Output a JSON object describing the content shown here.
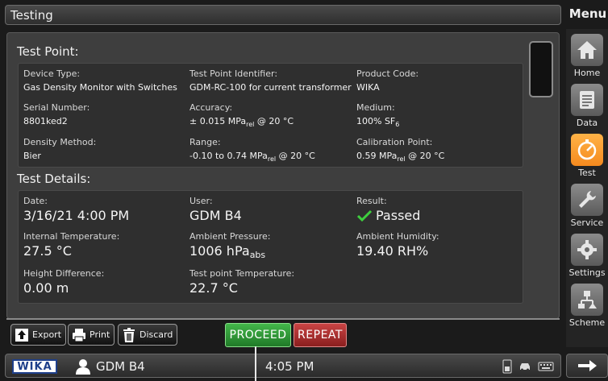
{
  "header": {
    "title": "Testing"
  },
  "menu": {
    "title": "Menu",
    "items": [
      {
        "label": "Home",
        "icon": "home-icon"
      },
      {
        "label": "Data",
        "icon": "document-icon"
      },
      {
        "label": "Test",
        "icon": "gauge-icon",
        "active": true
      },
      {
        "label": "Service",
        "icon": "wrench-icon"
      },
      {
        "label": "Settings",
        "icon": "gear-icon"
      },
      {
        "label": "Scheme",
        "icon": "scheme-icon"
      }
    ]
  },
  "test_point": {
    "title": "Test Point:",
    "device_type": {
      "label": "Device Type:",
      "value": "Gas Density Monitor with Switches"
    },
    "identifier": {
      "label": "Test Point Identifier:",
      "value": "GDM-RC-100 for current transformer"
    },
    "product_code": {
      "label": "Product Code:",
      "value": "WIKA"
    },
    "serial": {
      "label": "Serial Number:",
      "value": "8801ked2"
    },
    "accuracy": {
      "label": "Accuracy:",
      "pre": "± 0.015 MPa",
      "sub": "rel",
      "post": " @ 20 °C"
    },
    "medium": {
      "label": "Medium:",
      "pre": "100% SF",
      "sub": "6"
    },
    "density_method": {
      "label": "Density Method:",
      "value": "Bier"
    },
    "range": {
      "label": "Range:",
      "pre": "-0.10 to 0.74 MPa",
      "sub": "rel",
      "post": " @ 20 °C"
    },
    "calibration": {
      "label": "Calibration Point:",
      "pre": "0.59 MPa",
      "sub": "rel",
      "post": " @ 20 °C"
    }
  },
  "test_details": {
    "title": "Test Details:",
    "date": {
      "label": "Date:",
      "value": "3/16/21 4:00 PM"
    },
    "user": {
      "label": "User:",
      "value": "GDM B4"
    },
    "result": {
      "label": "Result:",
      "value": "Passed"
    },
    "internal_temp": {
      "label": "Internal Temperature:",
      "value": "27.5 °C"
    },
    "ambient_pressure": {
      "label": "Ambient Pressure:",
      "pre": "1006 hPa",
      "sub": "abs"
    },
    "ambient_humidity": {
      "label": "Ambient Humidity:",
      "value": "19.40 RH%"
    },
    "height_diff": {
      "label": "Height Difference:",
      "value": "0.00 m"
    },
    "tp_temp": {
      "label": "Test point Temperature:",
      "value": "22.7 °C"
    }
  },
  "actions": {
    "export": "Export",
    "print": "Print",
    "discard": "Discard",
    "proceed": "PROCEED",
    "repeat": "REPEAT"
  },
  "status": {
    "brand": "WIKA",
    "user": "GDM B4",
    "time": "4:05 PM"
  },
  "colors": {
    "accent_active": "#f58a1f",
    "proceed": "#2e9a36",
    "repeat": "#b03030",
    "passed_check": "#3ecf3e"
  }
}
